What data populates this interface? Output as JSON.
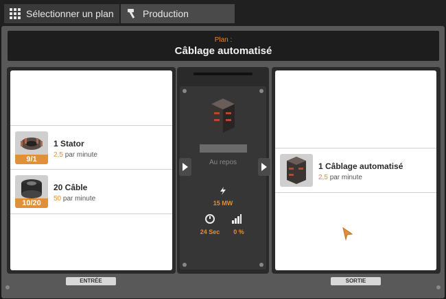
{
  "tabs": [
    {
      "label": "Sélectionner un plan",
      "icon": "grid-icon"
    },
    {
      "label": "Production",
      "icon": "hammer-icon"
    }
  ],
  "plan": {
    "label": "Plan :",
    "title": "Câblage automatisé"
  },
  "inputs": [
    {
      "name": "1 Stator",
      "rate": "2,5",
      "unit": "par minute",
      "badge": "9/1",
      "badge_color": "#e0903a",
      "icon": "stator-icon"
    },
    {
      "name": "20 Câble",
      "rate": "50",
      "unit": "par minute",
      "badge": "10/20",
      "badge_color": "#e0903a",
      "icon": "cable-icon"
    }
  ],
  "output": {
    "name": "1 Câblage automatisé",
    "rate": "2,5",
    "unit": "par minute",
    "icon": "automated-wiring-icon"
  },
  "machine": {
    "status": "Au repos",
    "power": "15 MW",
    "cycle": "24 Sec",
    "productivity": "0 %"
  },
  "labels": {
    "input": "ENTRÉE",
    "output": "SORTIE"
  },
  "colors": {
    "accent": "#e0903a",
    "panel_bg": "#ffffff",
    "frame": "#595959"
  }
}
